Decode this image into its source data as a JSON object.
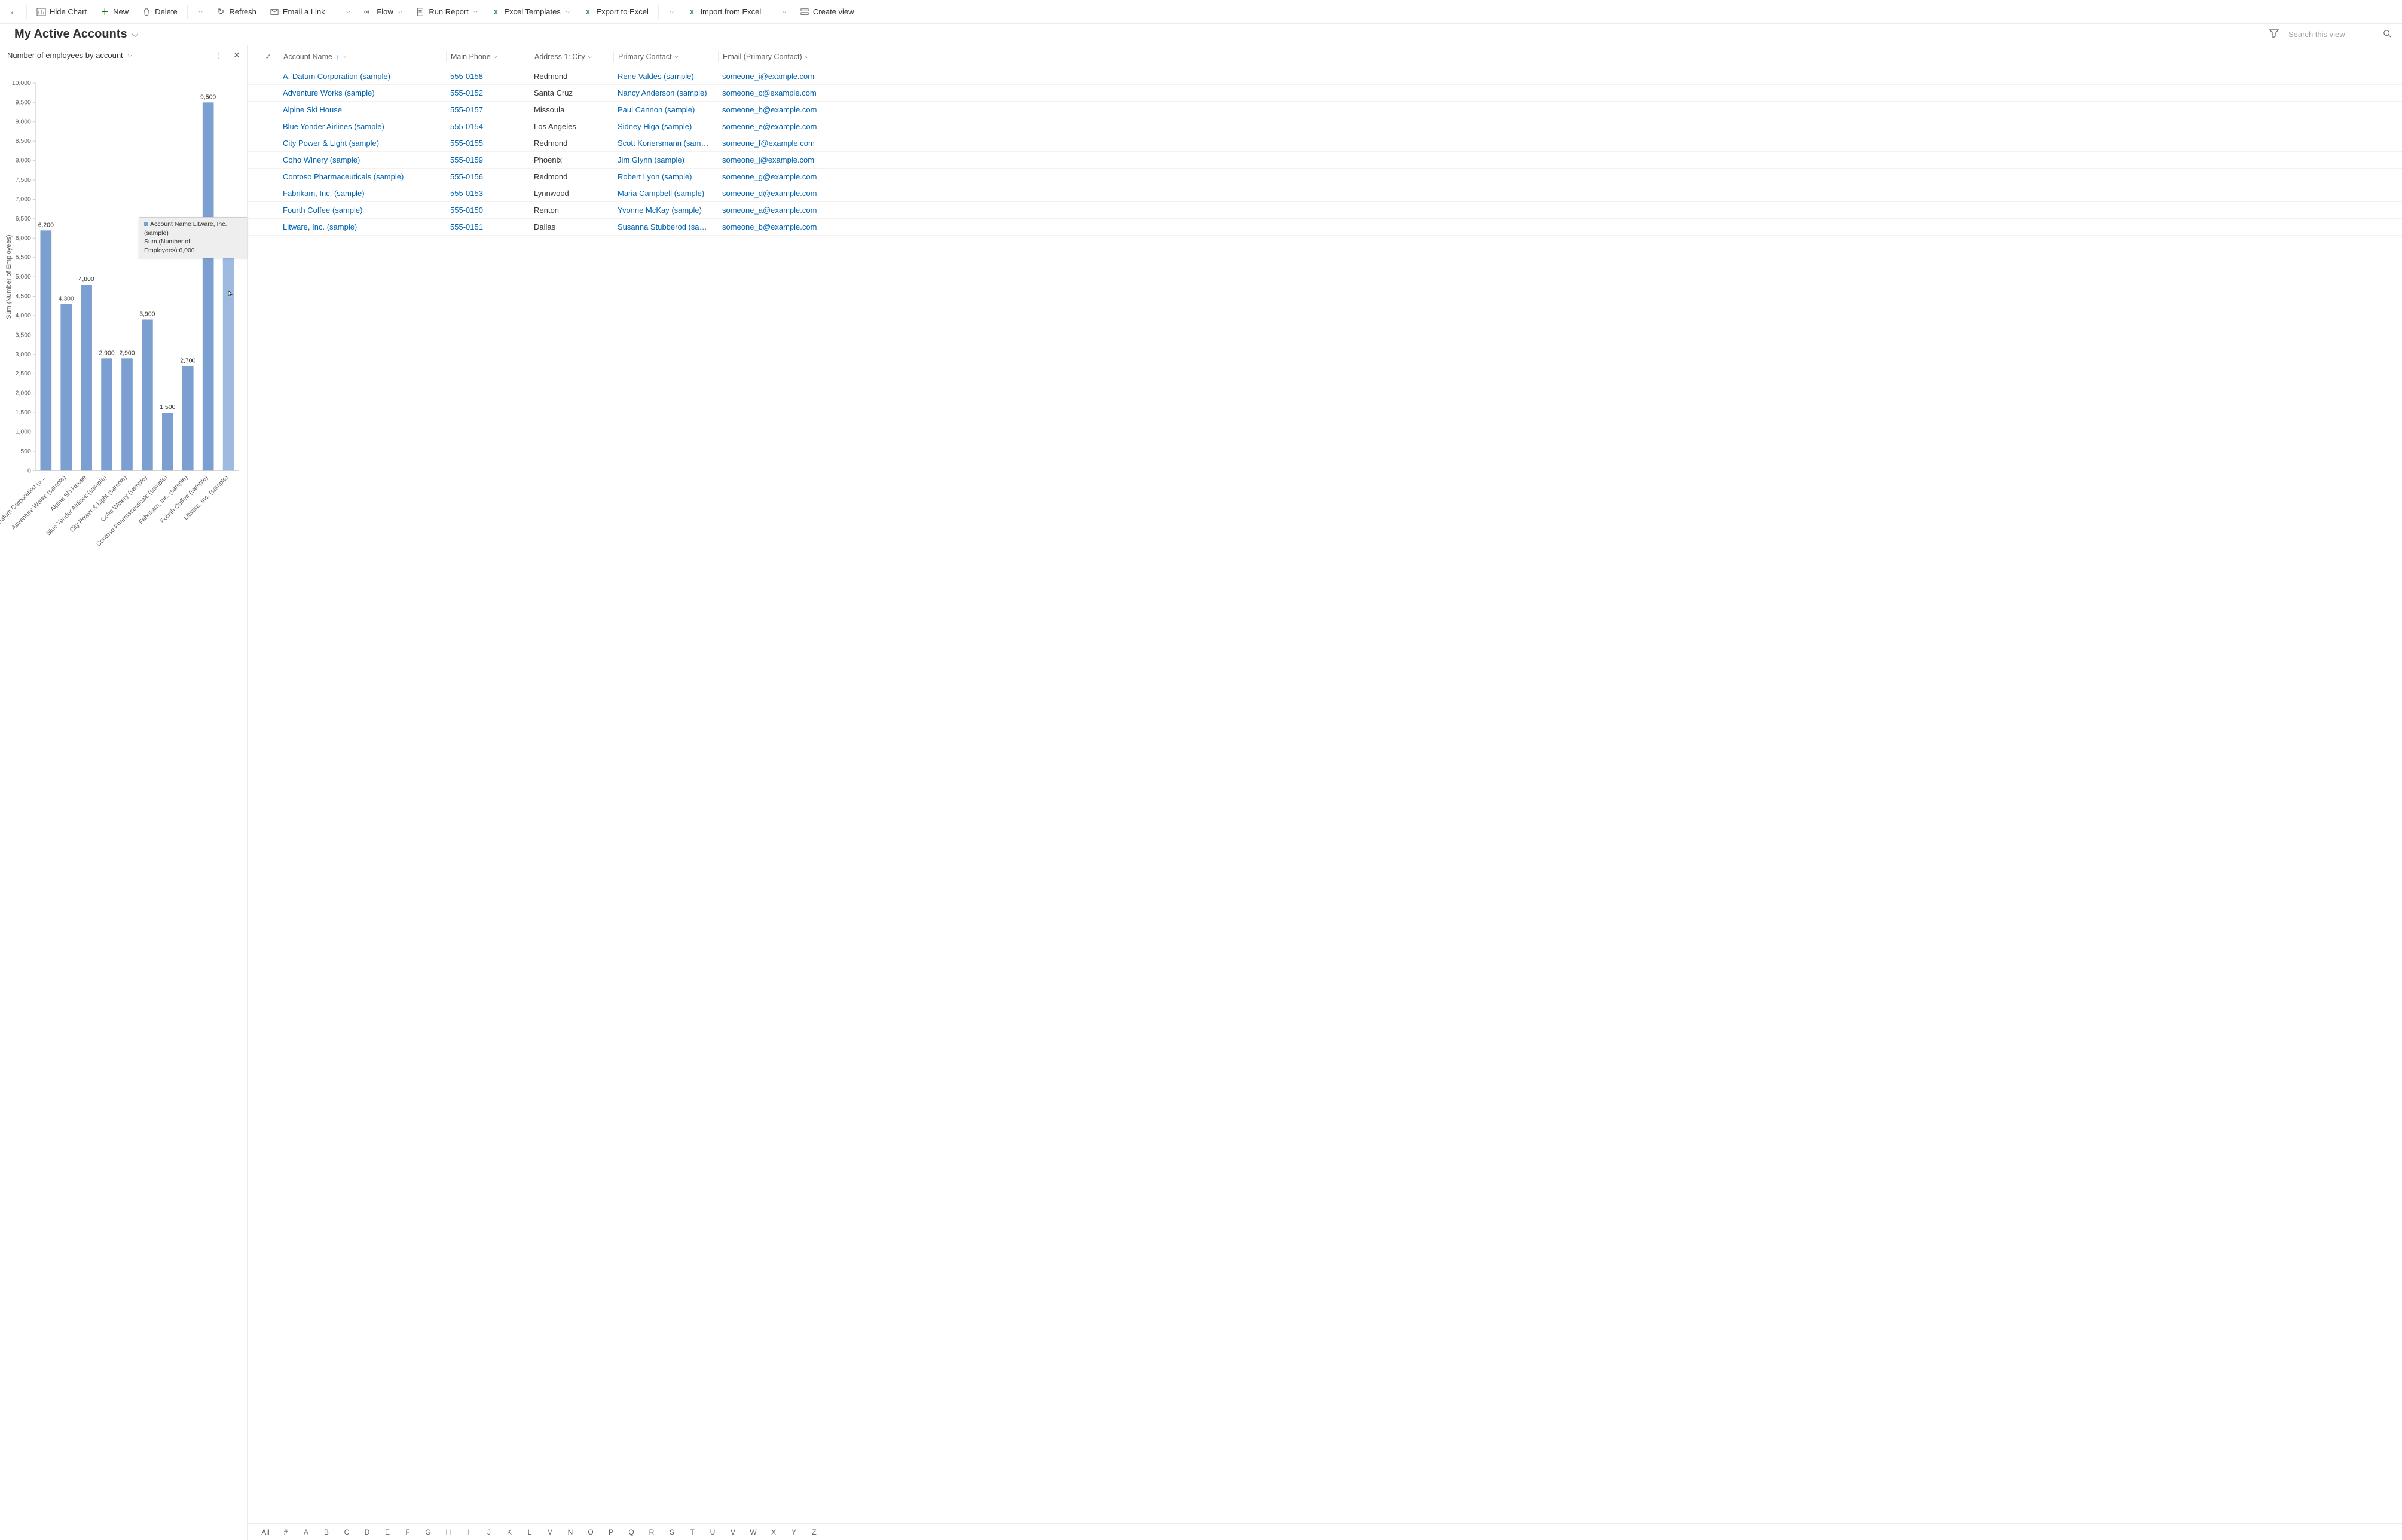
{
  "toolbar": {
    "hide_chart_label": "Hide Chart",
    "new_label": "New",
    "delete_label": "Delete",
    "refresh_label": "Refresh",
    "email_link_label": "Email a Link",
    "flow_label": "Flow",
    "run_report_label": "Run Report",
    "excel_templates_label": "Excel Templates",
    "export_excel_label": "Export to Excel",
    "import_excel_label": "Import from Excel",
    "create_view_label": "Create view"
  },
  "header": {
    "view_title": "My Active Accounts",
    "search_placeholder": "Search this view"
  },
  "chart": {
    "title": "Number of employees by account",
    "y_axis_label": "Sum (Number of Employees)",
    "tooltip_line1": "Account Name:Litware, Inc. (sample)",
    "tooltip_line2": "Sum (Number of Employees):6,000"
  },
  "grid": {
    "columns": {
      "account_name": "Account Name",
      "main_phone": "Main Phone",
      "city": "Address 1: City",
      "primary_contact": "Primary Contact",
      "email": "Email (Primary Contact)"
    },
    "rows": [
      {
        "name": "A. Datum Corporation (sample)",
        "phone": "555-0158",
        "city": "Redmond",
        "contact": "Rene Valdes (sample)",
        "email": "someone_i@example.com"
      },
      {
        "name": "Adventure Works (sample)",
        "phone": "555-0152",
        "city": "Santa Cruz",
        "contact": "Nancy Anderson (sample)",
        "email": "someone_c@example.com"
      },
      {
        "name": "Alpine Ski House",
        "phone": "555-0157",
        "city": "Missoula",
        "contact": "Paul Cannon (sample)",
        "email": "someone_h@example.com"
      },
      {
        "name": "Blue Yonder Airlines (sample)",
        "phone": "555-0154",
        "city": "Los Angeles",
        "contact": "Sidney Higa (sample)",
        "email": "someone_e@example.com"
      },
      {
        "name": "City Power & Light (sample)",
        "phone": "555-0155",
        "city": "Redmond",
        "contact": "Scott Konersmann (sample)",
        "email": "someone_f@example.com"
      },
      {
        "name": "Coho Winery (sample)",
        "phone": "555-0159",
        "city": "Phoenix",
        "contact": "Jim Glynn (sample)",
        "email": "someone_j@example.com"
      },
      {
        "name": "Contoso Pharmaceuticals (sample)",
        "phone": "555-0156",
        "city": "Redmond",
        "contact": "Robert Lyon (sample)",
        "email": "someone_g@example.com"
      },
      {
        "name": "Fabrikam, Inc. (sample)",
        "phone": "555-0153",
        "city": "Lynnwood",
        "contact": "Maria Campbell (sample)",
        "email": "someone_d@example.com"
      },
      {
        "name": "Fourth Coffee (sample)",
        "phone": "555-0150",
        "city": "Renton",
        "contact": "Yvonne McKay (sample)",
        "email": "someone_a@example.com"
      },
      {
        "name": "Litware, Inc. (sample)",
        "phone": "555-0151",
        "city": "Dallas",
        "contact": "Susanna Stubberod (sample)",
        "email": "someone_b@example.com"
      }
    ]
  },
  "alpha": {
    "items": [
      "All",
      "#",
      "A",
      "B",
      "C",
      "D",
      "E",
      "F",
      "G",
      "H",
      "I",
      "J",
      "K",
      "L",
      "M",
      "N",
      "O",
      "P",
      "Q",
      "R",
      "S",
      "T",
      "U",
      "V",
      "W",
      "X",
      "Y",
      "Z"
    ]
  },
  "chart_data": {
    "type": "bar",
    "title": "Number of employees by account",
    "ylabel": "Sum (Number of Employees)",
    "xlabel": "",
    "ylim": [
      0,
      10000
    ],
    "ytick_step": 500,
    "categories": [
      "A. Datum Corporation (s…",
      "Adventure Works (sample)",
      "Alpine Ski House",
      "Blue Yonder Airlines (sample)",
      "City Power & Light (sample)",
      "Coho Winery (sample)",
      "Contoso Pharmaceuticals (sample)",
      "Fabrikam, Inc. (sample)",
      "Fourth Coffee (sample)",
      "Litware, Inc. (sample)"
    ],
    "values": [
      6200,
      4300,
      4800,
      2900,
      2900,
      3900,
      1500,
      2700,
      9500,
      6000
    ],
    "color": "#7b9fd1"
  }
}
